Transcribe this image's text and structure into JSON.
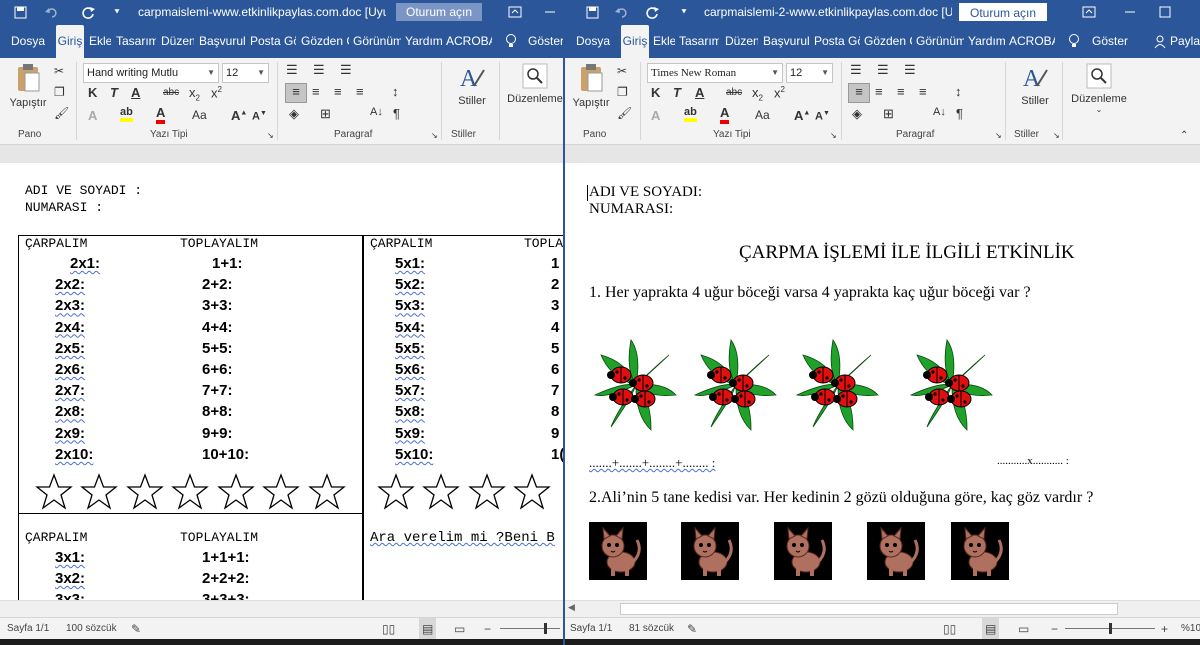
{
  "colors": {
    "accent": "#2b579a",
    "squiggle": "#4a6fd1",
    "ladybug": "#e01010",
    "leaf": "#1fa12a",
    "cat": "#b07060"
  },
  "left": {
    "title": "carpmaislemi-www.etkinlikpaylas.com.doc [Uyu...",
    "signin": "Oturum açın",
    "tabs": [
      "Dosya",
      "Giriş",
      "Ekle",
      "Tasarım",
      "Düzen",
      "Başvurula",
      "Posta Gö",
      "Gözden G",
      "Görünüm",
      "Yardım",
      "ACROBA",
      "Göster"
    ],
    "ribbon": {
      "paste": "Yapıştır",
      "font": "Hand writing Mutlu",
      "size": "12",
      "styles": "Stiller",
      "edit": "Düzenleme",
      "groups": [
        "Pano",
        "Yazı Tipi",
        "Paragraf",
        "Stiller"
      ]
    },
    "doc": {
      "name_label": "ADI VE SOYADI :",
      "number_label": "NUMARASI    :",
      "h_carp": "ÇARPALIM",
      "h_topla": "TOPLAYALIM",
      "h_topla_cut": "TOPLA",
      "col1": [
        "2x1:",
        "2x2:",
        "2x3:",
        "2x4:",
        "2x5:",
        "2x6:",
        "2x7:",
        "2x8:",
        "2x9:",
        "2x10:"
      ],
      "col2": [
        "1+1:",
        "2+2:",
        "3+3:",
        "4+4:",
        "5+5:",
        "6+6:",
        "7+7:",
        "8+8:",
        "9+9:",
        "10+10:"
      ],
      "col3": [
        "5x1:",
        "5x2:",
        "5x3:",
        "5x4:",
        "5x5:",
        "5x6:",
        "5x7:",
        "5x8:",
        "5x9:",
        "5x10:"
      ],
      "col4": [
        "1",
        "2",
        "3",
        "4",
        "5",
        "6",
        "7",
        "8",
        "9",
        "1("
      ],
      "lower_carp": "ÇARPALIM",
      "lower_topla": "TOPLAYALIM",
      "lower_col1": [
        "3x1:",
        "3x2:",
        "3x3:"
      ],
      "lower_col2": [
        "1+1+1:",
        "2+2+2:",
        "3+3+3:"
      ],
      "ara": "Ara verelim mi ?Beni B"
    },
    "status": {
      "page": "Sayfa 1/1",
      "words": "100 sözcük"
    }
  },
  "right": {
    "title": "carpmaislemi-2-www.etkinlikpaylas.com.doc [U...",
    "signin": "Oturum açın",
    "tabs": [
      "Dosya",
      "Giriş",
      "Ekle",
      "Tasarım",
      "Düzen",
      "Başvurula",
      "Posta Gö",
      "Gözden G",
      "Görünüm",
      "Yardım",
      "ACROBA",
      "Göster",
      "Payla"
    ],
    "ribbon": {
      "paste": "Yapıştır",
      "font": "Times New Roman",
      "size": "12",
      "styles": "Stiller",
      "edit": "Düzenleme",
      "groups": [
        "Pano",
        "Yazı Tipi",
        "Paragraf",
        "Stiller"
      ]
    },
    "doc": {
      "name_label": "ADI VE SOYADI:",
      "number_label": "NUMARASI:",
      "heading": "ÇARPMA İŞLEMİ İLE İLGİLİ ETKİNLİK",
      "q1": "1.  Her yaprakta 4 uğur böceği varsa 4 yaprakta kaç uğur böceği  var ?",
      "dots_sum": ".......+.......+........+........ :",
      "dots_mult": "...........x........... :",
      "q2": "2.Ali’nin 5 tane kedisi var. Her kedinin 2 gözü olduğuna göre,  kaç  göz  vardır ?"
    },
    "status": {
      "page": "Sayfa 1/1",
      "words": "81 sözcük",
      "zoom": "%10"
    }
  },
  "icons": [
    "save-icon",
    "undo-icon",
    "redo-icon",
    "customize-icon",
    "minimize-icon",
    "maximize-icon",
    "lightbulb-icon",
    "share-icon",
    "paste-icon",
    "cut-icon",
    "copy-icon",
    "format-painter-icon",
    "bold-icon",
    "italic-icon",
    "underline-icon",
    "strikethrough-icon",
    "subscript-icon",
    "superscript-icon",
    "bullets-icon",
    "numbering-icon",
    "align-left-icon",
    "center-icon",
    "align-right-icon",
    "justify-icon",
    "styles-icon",
    "find-icon",
    "star-icon",
    "ladybug-leaf-image",
    "cat-image"
  ]
}
